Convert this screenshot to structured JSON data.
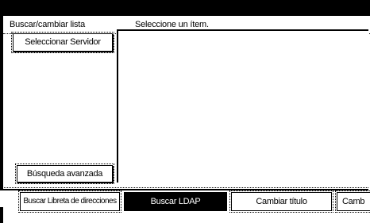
{
  "header": {
    "title": "Buscar/cambiar lista",
    "message": "Seleccione un ítem."
  },
  "left_panel": {
    "server_button": "Seleccionar Servidor",
    "advanced_button": "Búsqueda avanzada"
  },
  "tabs": [
    {
      "label": "Buscar Libreta de direcciones",
      "selected": false
    },
    {
      "label": "Buscar LDAP",
      "selected": true
    },
    {
      "label": "Cambiar título",
      "selected": false
    },
    {
      "label": "Camb",
      "selected": false
    }
  ],
  "colors": {
    "background": "#000000",
    "screen": "#ffffff",
    "selected_tab": "#000000",
    "selected_tab_text": "#ffffff"
  }
}
